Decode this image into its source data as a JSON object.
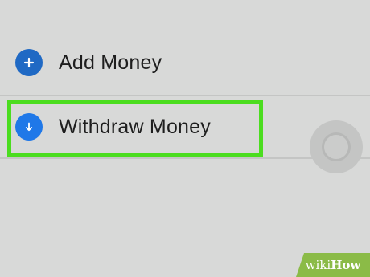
{
  "menu": {
    "add_money": {
      "label": "Add Money",
      "icon": "plus-icon",
      "icon_color": "#1f69c4"
    },
    "withdraw_money": {
      "label": "Withdraw Money",
      "icon": "arrow-down-icon",
      "icon_color": "#1f78e8",
      "highlighted": true
    }
  },
  "highlight_color": "#4bdd1f",
  "watermark": {
    "wiki": "wiki",
    "how": "How",
    "color": "#8bbb47"
  }
}
